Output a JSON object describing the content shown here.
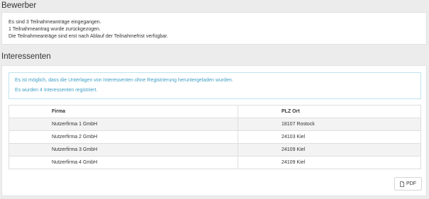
{
  "bewerber": {
    "title": "Bewerber",
    "lines": [
      "Es sind 3 Teilnahmeanträge eingegangen.",
      "1 Teilnahmeantrag wurde zurückgezogen.",
      "Die Teilnahmeanträge sind erst nach Ablauf der Teilnahmefrist verfügbar."
    ]
  },
  "interessenten": {
    "title": "Interessenten",
    "info": [
      "Es ist möglich, dass die Unterlagen von Interessenten ohne Registrierung heruntergeladen wurden.",
      "Es wurden 4 Interessenten registriert."
    ],
    "columns": [
      "Firma",
      "PLZ Ort"
    ],
    "rows": [
      [
        "Nutzerfirma 1 GmbH",
        "18107 Rostock"
      ],
      [
        "Nutzerfirma 2 GmbH",
        "24103 Kiel"
      ],
      [
        "Nutzerfirma 3 GmbH",
        "24109 Kiel"
      ],
      [
        "Nutzerfirma 4 GmbH",
        "24109 Kiel"
      ]
    ],
    "pdf_label": "PDF",
    "pdf_icon": "file-icon"
  },
  "colors": {
    "info_text": "#3f9fc4",
    "info_border": "#bfe3ee",
    "background": "#ececec"
  }
}
